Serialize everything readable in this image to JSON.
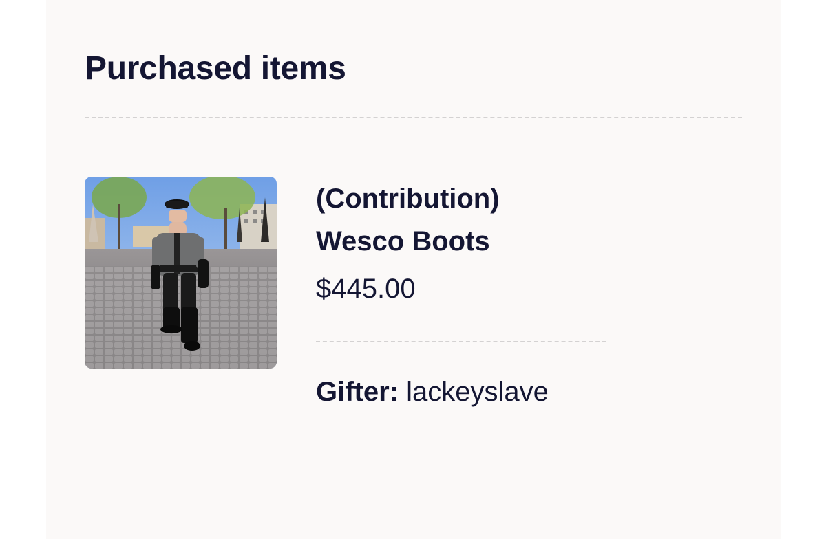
{
  "section": {
    "title": "Purchased items"
  },
  "item": {
    "image_alt": "Product photo: person in leather uniform standing on a cobblestone plaza",
    "type_label": "(Contribution)",
    "name": "Wesco Boots",
    "price": "$445.00",
    "gifter_label": "Gifter:",
    "gifter_value": "lackeyslave"
  },
  "colors": {
    "text": "#141633",
    "panel_background": "#fbf9f8",
    "divider": "#d4d2d2"
  }
}
